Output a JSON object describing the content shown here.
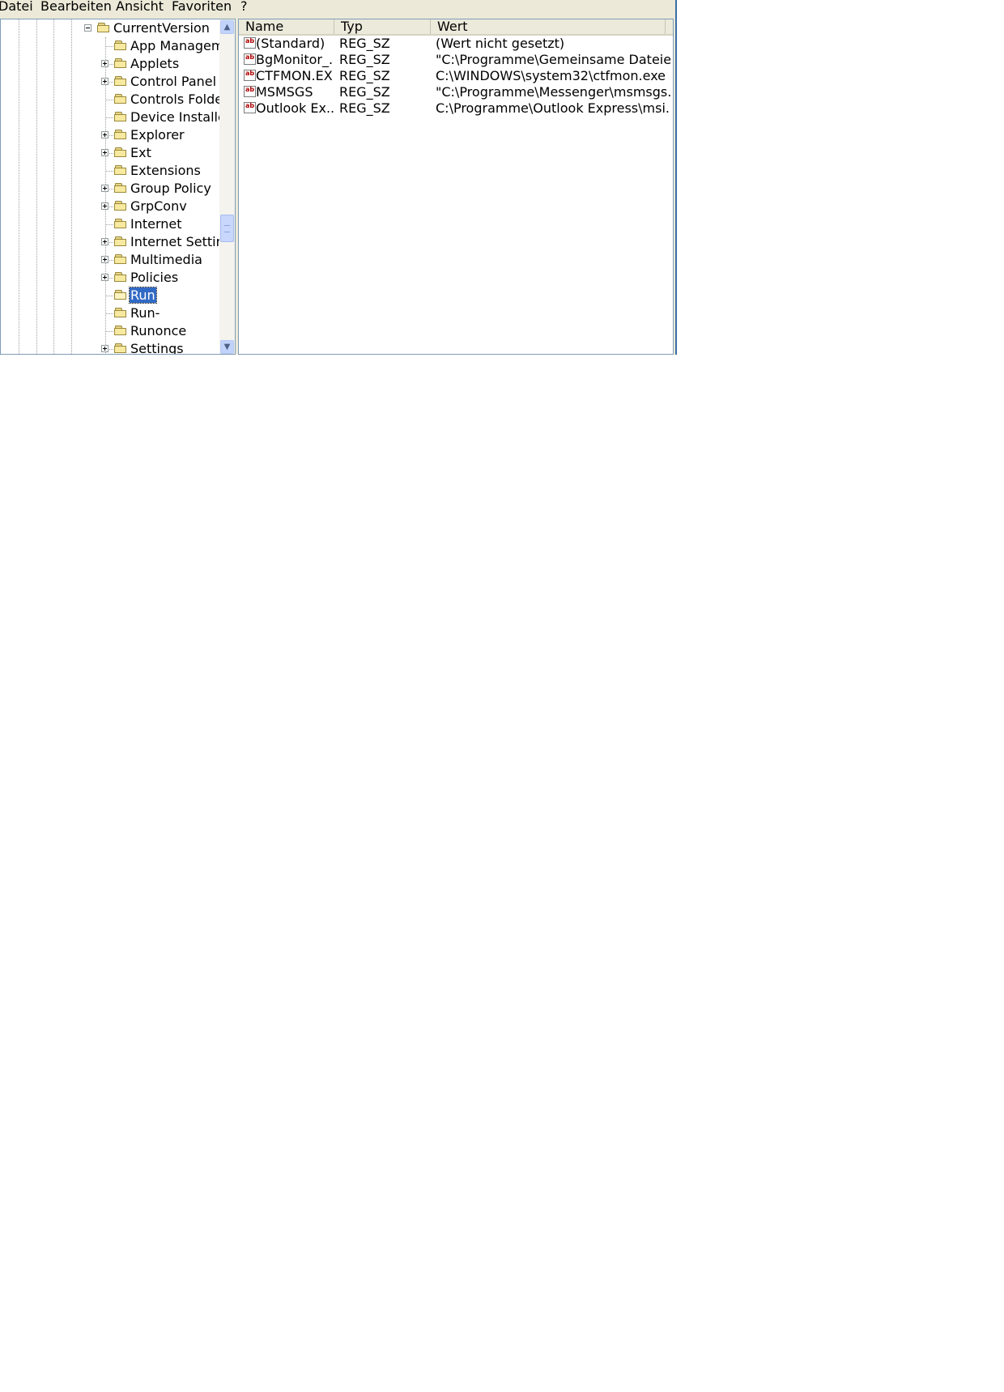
{
  "menu": [
    "Datei",
    "Bearbeiten",
    "Ansicht",
    "Favoriten",
    "?"
  ],
  "tree": {
    "items": [
      {
        "label": "CurrentVersion",
        "expander": "minus",
        "level": 0
      },
      {
        "label": "App Manageme",
        "expander": "none",
        "level": 1
      },
      {
        "label": "Applets",
        "expander": "plus",
        "level": 1
      },
      {
        "label": "Control Panel",
        "expander": "plus",
        "level": 1
      },
      {
        "label": "Controls Folder",
        "expander": "none",
        "level": 1
      },
      {
        "label": "Device Installer",
        "expander": "none",
        "level": 1
      },
      {
        "label": "Explorer",
        "expander": "plus",
        "level": 1
      },
      {
        "label": "Ext",
        "expander": "plus",
        "level": 1
      },
      {
        "label": "Extensions",
        "expander": "none",
        "level": 1
      },
      {
        "label": "Group Policy",
        "expander": "plus",
        "level": 1
      },
      {
        "label": "GrpConv",
        "expander": "plus",
        "level": 1
      },
      {
        "label": "Internet",
        "expander": "none",
        "level": 1
      },
      {
        "label": "Internet Setting",
        "expander": "plus",
        "level": 1
      },
      {
        "label": "Multimedia",
        "expander": "plus",
        "level": 1
      },
      {
        "label": "Policies",
        "expander": "plus",
        "level": 1
      },
      {
        "label": "Run",
        "expander": "none",
        "level": 1,
        "selected": true
      },
      {
        "label": "Run-",
        "expander": "none",
        "level": 1
      },
      {
        "label": "Runonce",
        "expander": "none",
        "level": 1
      },
      {
        "label": "Settings",
        "expander": "plus",
        "level": 1
      }
    ]
  },
  "list": {
    "columns": [
      "Name",
      "Typ",
      "Wert"
    ],
    "rows": [
      {
        "icon": "ab",
        "name": "(Standard)",
        "type": "REG_SZ",
        "value": "(Wert nicht gesetzt)"
      },
      {
        "icon": "ab",
        "name": "BgMonitor_...",
        "type": "REG_SZ",
        "value": "\"C:\\Programme\\Gemeinsame Dateie..."
      },
      {
        "icon": "ab",
        "name": "CTFMON.EXE",
        "type": "REG_SZ",
        "value": "C:\\WINDOWS\\system32\\ctfmon.exe"
      },
      {
        "icon": "ab",
        "name": "MSMSGS",
        "type": "REG_SZ",
        "value": "\"C:\\Programme\\Messenger\\msmsgs...."
      },
      {
        "icon": "ab",
        "name": "Outlook Ex...",
        "type": "REG_SZ",
        "value": "C:\\Programme\\Outlook Express\\msi..."
      }
    ]
  },
  "colors": {
    "selection": "#316ac5",
    "window_bg": "#ece9d8",
    "border_blue": "#3a6ea5"
  },
  "icons": {
    "folder": "folder-icon",
    "open_folder": "folder-open-icon",
    "registry_string": "reg-sz-icon",
    "scroll_up": "scroll-up-arrow-icon",
    "scroll_down": "scroll-down-arrow-icon"
  }
}
